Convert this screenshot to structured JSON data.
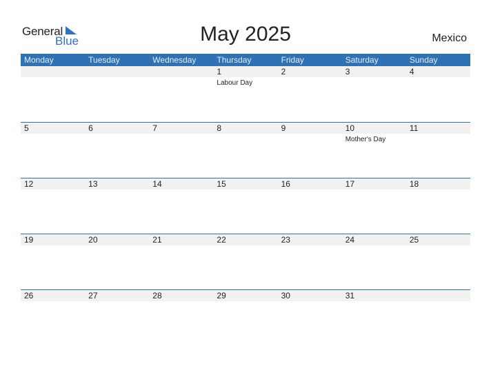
{
  "logo": {
    "word1": "General",
    "word2": "Blue"
  },
  "title": "May 2025",
  "country": "Mexico",
  "colors": {
    "accent": "#2e72b5",
    "band": "#f1f1f1"
  },
  "weekdays": [
    "Monday",
    "Tuesday",
    "Wednesday",
    "Thursday",
    "Friday",
    "Saturday",
    "Sunday"
  ],
  "weeks": [
    [
      {
        "day": "",
        "event": ""
      },
      {
        "day": "",
        "event": ""
      },
      {
        "day": "",
        "event": ""
      },
      {
        "day": "1",
        "event": "Labour Day"
      },
      {
        "day": "2",
        "event": ""
      },
      {
        "day": "3",
        "event": ""
      },
      {
        "day": "4",
        "event": ""
      }
    ],
    [
      {
        "day": "5",
        "event": ""
      },
      {
        "day": "6",
        "event": ""
      },
      {
        "day": "7",
        "event": ""
      },
      {
        "day": "8",
        "event": ""
      },
      {
        "day": "9",
        "event": ""
      },
      {
        "day": "10",
        "event": "Mother's Day"
      },
      {
        "day": "11",
        "event": ""
      }
    ],
    [
      {
        "day": "12",
        "event": ""
      },
      {
        "day": "13",
        "event": ""
      },
      {
        "day": "14",
        "event": ""
      },
      {
        "day": "15",
        "event": ""
      },
      {
        "day": "16",
        "event": ""
      },
      {
        "day": "17",
        "event": ""
      },
      {
        "day": "18",
        "event": ""
      }
    ],
    [
      {
        "day": "19",
        "event": ""
      },
      {
        "day": "20",
        "event": ""
      },
      {
        "day": "21",
        "event": ""
      },
      {
        "day": "22",
        "event": ""
      },
      {
        "day": "23",
        "event": ""
      },
      {
        "day": "24",
        "event": ""
      },
      {
        "day": "25",
        "event": ""
      }
    ],
    [
      {
        "day": "26",
        "event": ""
      },
      {
        "day": "27",
        "event": ""
      },
      {
        "day": "28",
        "event": ""
      },
      {
        "day": "29",
        "event": ""
      },
      {
        "day": "30",
        "event": ""
      },
      {
        "day": "31",
        "event": ""
      },
      {
        "day": "",
        "event": ""
      }
    ]
  ]
}
